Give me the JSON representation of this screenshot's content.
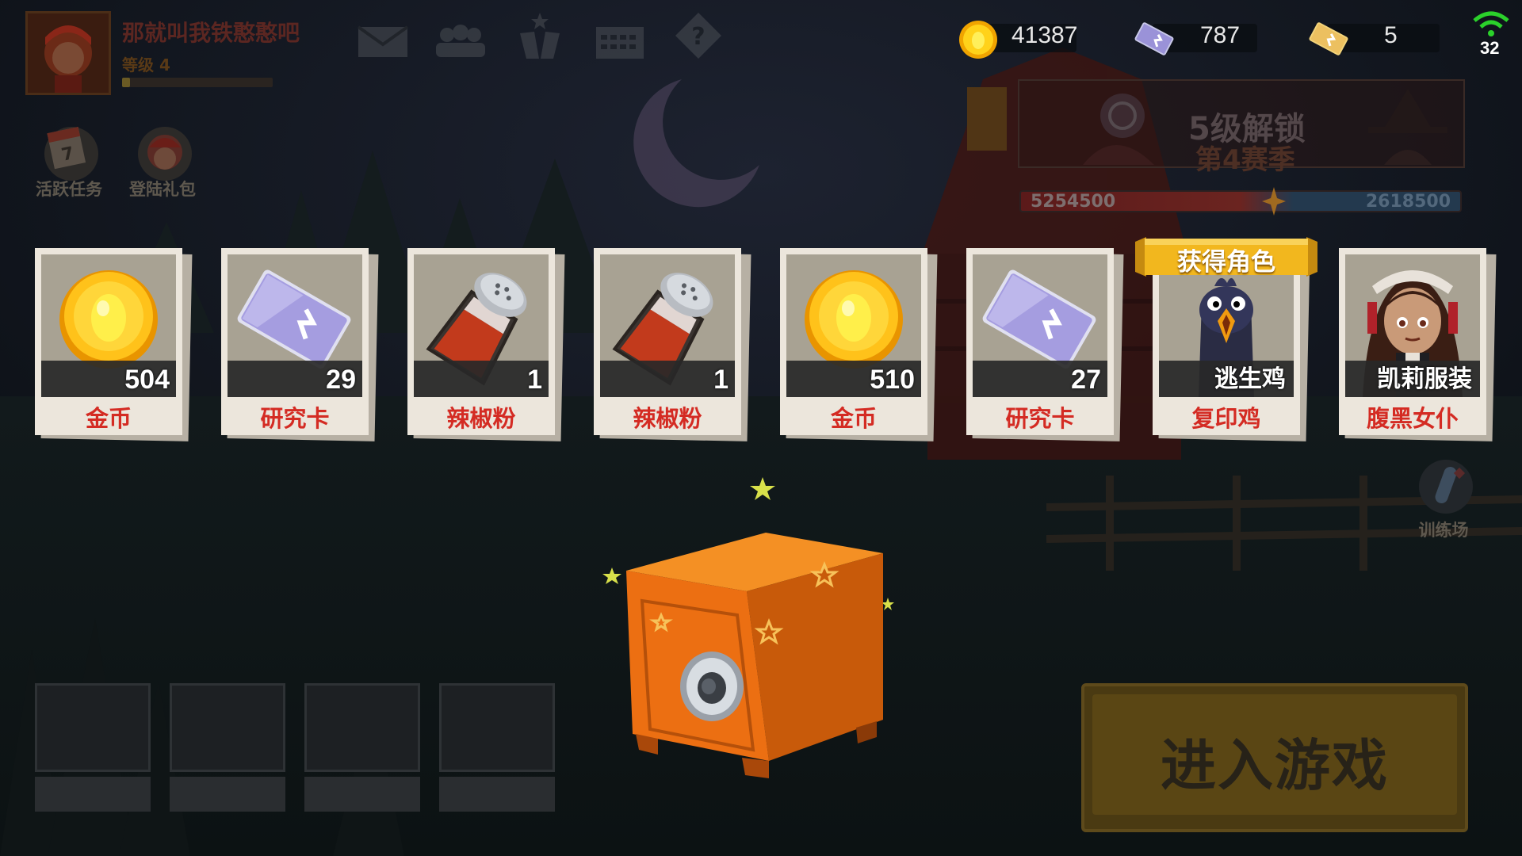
{
  "player": {
    "name": "那就叫我铁憨憨吧",
    "level_label": "等级 4",
    "xp_progress": 0.05
  },
  "top_icons": [
    "mail-icon",
    "friends-icon",
    "ranking-icon",
    "calendar-icon",
    "help-icon"
  ],
  "currencies": [
    {
      "icon": "gold-coin-icon",
      "value": "41387"
    },
    {
      "icon": "research-card-icon",
      "value": "787"
    },
    {
      "icon": "ticket-icon",
      "value": "5"
    }
  ],
  "signal": {
    "value": "32"
  },
  "side_buttons": {
    "daily_tasks": "活跃任务",
    "login_gift": "登陆礼包",
    "training": "训练场"
  },
  "season": {
    "line1": "5级解锁",
    "line2": "第4赛季",
    "score_left": "5254500",
    "score_right": "2618500"
  },
  "rewards": [
    {
      "name": "金币",
      "count": "504",
      "icon": "gold-coin-icon"
    },
    {
      "name": "研究卡",
      "count": "29",
      "icon": "research-card-icon"
    },
    {
      "name": "辣椒粉",
      "count": "1",
      "icon": "chili-powder-icon"
    },
    {
      "name": "辣椒粉",
      "count": "1",
      "icon": "chili-powder-icon"
    },
    {
      "name": "金币",
      "count": "510",
      "icon": "gold-coin-icon"
    },
    {
      "name": "研究卡",
      "count": "27",
      "icon": "research-card-icon"
    },
    {
      "name": "复印鸡",
      "subname": "逃生鸡",
      "ribbon": "获得角色",
      "icon": "chicken-character-icon"
    },
    {
      "name": "腹黑女仆",
      "subname": "凯莉服装",
      "icon": "maid-outfit-icon"
    }
  ],
  "enter_button": "进入游戏",
  "colors": {
    "reward_name": "#d42b23",
    "safe": "#f07a14",
    "gold": "#f5b400"
  }
}
